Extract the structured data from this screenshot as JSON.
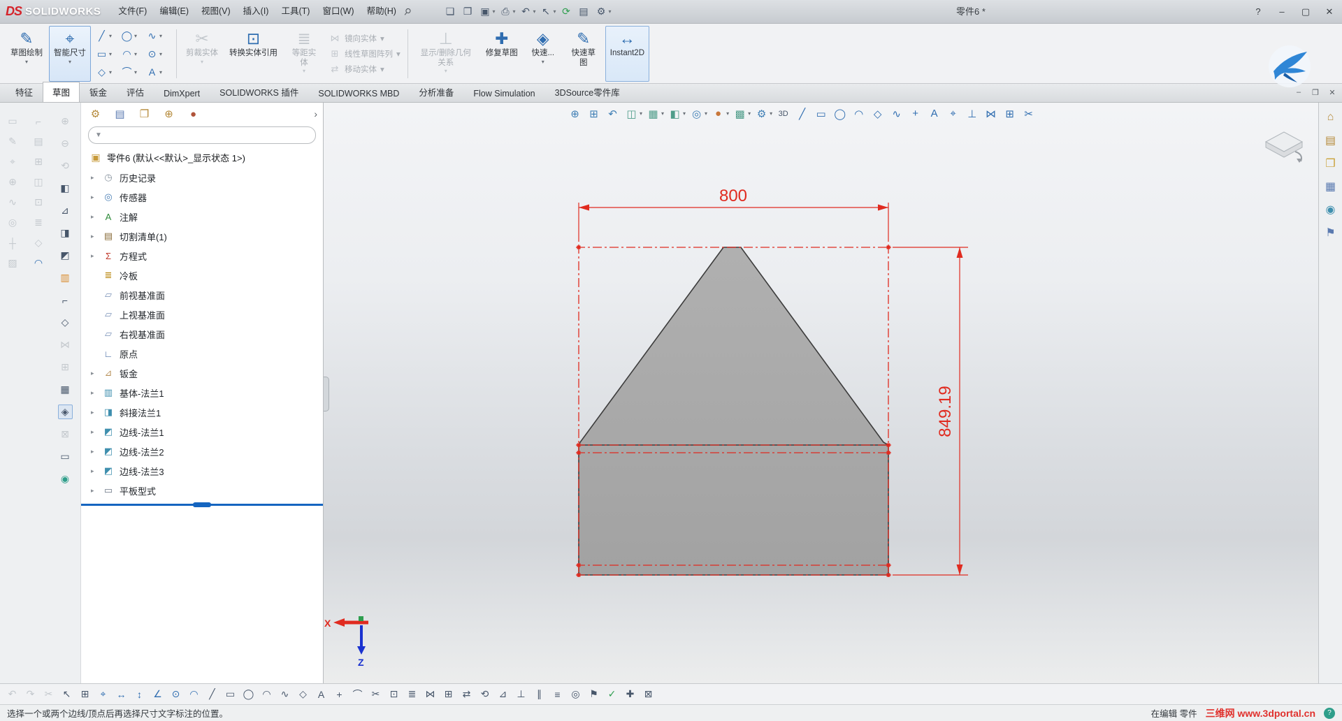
{
  "colors": {
    "accent": "#2f6db0",
    "dim_red": "#e02b20",
    "shape_fill": "#a8a8a8",
    "rollback_blue": "#1565c0"
  },
  "title_bar": {
    "logo_ds": "DS",
    "logo_text": "SOLIDWORKS",
    "menus": [
      {
        "id": "file",
        "label": "文件(F)"
      },
      {
        "id": "edit",
        "label": "编辑(E)"
      },
      {
        "id": "view",
        "label": "视图(V)"
      },
      {
        "id": "insert",
        "label": "插入(I)"
      },
      {
        "id": "tools",
        "label": "工具(T)"
      },
      {
        "id": "window",
        "label": "窗口(W)"
      },
      {
        "id": "help",
        "label": "帮助(H)"
      }
    ],
    "quick_access": [
      {
        "n": "new-document-icon",
        "g": "❏"
      },
      {
        "n": "open-document-icon",
        "g": "❐"
      },
      {
        "n": "save-icon",
        "g": "▣",
        "dd": 1
      },
      {
        "n": "print-icon",
        "g": "⎙",
        "dd": 1
      },
      {
        "n": "undo-icon",
        "g": "↶",
        "dd": 1
      },
      {
        "n": "select-icon",
        "g": "↖",
        "dd": 1
      },
      {
        "n": "rebuild-icon",
        "g": "⟳",
        "c": "#2e9e4f"
      },
      {
        "n": "file-properties-icon",
        "g": "▤"
      },
      {
        "n": "options-icon",
        "g": "⚙",
        "dd": 1
      }
    ],
    "document_title": "零件6 *",
    "help_button": "?",
    "minimize_button": "–",
    "maximize_button": "▢",
    "close_button": "✕"
  },
  "ribbon": {
    "sketch": {
      "label": "草图绘制",
      "icon": "✎"
    },
    "smart_dimension": {
      "label": "智能尺寸",
      "icon": "⌖"
    },
    "entity_tools": [
      {
        "n": "line-tool-icon",
        "g": "╱",
        "c": "#2f6db0",
        "dd": 1
      },
      {
        "n": "circle-tool-icon",
        "g": "◯",
        "c": "#2f6db0",
        "dd": 1
      },
      {
        "n": "spline-tool-icon",
        "g": "∿",
        "c": "#2f6db0",
        "dd": 1
      },
      {
        "n": "rectangle-tool-icon",
        "g": "▭",
        "c": "#2f6db0",
        "dd": 1
      },
      {
        "n": "arc-tool-icon",
        "g": "◠",
        "c": "#2f6db0",
        "dd": 1
      },
      {
        "n": "ellipse-tool-icon",
        "g": "⊙",
        "c": "#2f6db0",
        "dd": 1
      },
      {
        "n": "polygon-tool-icon",
        "g": "◇",
        "c": "#2f6db0",
        "dd": 1
      },
      {
        "n": "fillet-tool-icon",
        "g": "⌒",
        "c": "#2f6db0",
        "dd": 1
      },
      {
        "n": "text-tool-icon",
        "g": "A",
        "c": "#2f6db0",
        "dd": 1
      }
    ],
    "trim": {
      "label": "剪裁实体",
      "icon": "✂"
    },
    "convert": {
      "label": "转换实体引用",
      "icon": "⊡"
    },
    "offset": {
      "label": "等距实体",
      "icon": "≣"
    },
    "mirror": {
      "label": "镜向实体",
      "icon": "⋈"
    },
    "linear_pattern": {
      "label": "线性草图阵列",
      "icon": "⊞"
    },
    "move": {
      "label": "移动实体",
      "icon": "⇄"
    },
    "relations": {
      "label": "显示/删除几何关系",
      "icon": "⊥"
    },
    "repair": {
      "label": "修复草图",
      "icon": "✚"
    },
    "quick_snaps": {
      "label": "快速...",
      "icon": "◈"
    },
    "rapid_sketch": {
      "label": "快速草图",
      "icon": "✎"
    },
    "instant2d": {
      "label": "Instant2D",
      "icon": "↔"
    }
  },
  "command_tabs": {
    "items": [
      {
        "id": "features",
        "label": "特征"
      },
      {
        "id": "sketch",
        "label": "草图",
        "active": true
      },
      {
        "id": "sheet-metal",
        "label": "钣金"
      },
      {
        "id": "evaluate",
        "label": "评估"
      },
      {
        "id": "dimxpert",
        "label": "DimXpert"
      },
      {
        "id": "solidworks-addins",
        "label": "SOLIDWORKS 插件"
      },
      {
        "id": "solidworks-mbd",
        "label": "SOLIDWORKS MBD"
      },
      {
        "id": "analysis-prep",
        "label": "分析准备"
      },
      {
        "id": "flow-simulation",
        "label": "Flow Simulation"
      },
      {
        "id": "3dsource-library",
        "label": "3DSource零件库"
      }
    ],
    "window_icons": [
      {
        "n": "doc-minimize-icon",
        "g": "–"
      },
      {
        "n": "doc-restore-icon",
        "g": "❐"
      },
      {
        "n": "doc-close-icon",
        "g": "✕"
      }
    ]
  },
  "left_dock": {
    "col1": [
      {
        "n": "note-tool-icon",
        "g": "▭",
        "d": 1
      },
      {
        "n": "surface-finish-icon",
        "g": "✎",
        "d": 1
      },
      {
        "n": "geometric-tolerance-icon",
        "g": "⌖",
        "d": 1
      },
      {
        "n": "datum-feature-icon",
        "g": "⊕",
        "d": 1
      },
      {
        "n": "weld-symbol-icon",
        "g": "∿",
        "d": 1
      },
      {
        "n": "balloon-icon",
        "g": "◎",
        "d": 1
      },
      {
        "n": "center-mark-icon",
        "g": "┼",
        "d": 1
      },
      {
        "n": "area-hatch-icon",
        "g": "▨",
        "d": 1
      }
    ],
    "col2": [
      {
        "n": "blocks-tool-icon",
        "g": "⌐",
        "d": 1
      },
      {
        "n": "table-tool-icon",
        "g": "▤",
        "d": 1
      },
      {
        "n": "pattern-tool-icon",
        "g": "⊞",
        "d": 1
      },
      {
        "n": "section-tool-icon",
        "g": "◫",
        "d": 1
      },
      {
        "n": "convert-tool-icon",
        "g": "⊡",
        "d": 1
      },
      {
        "n": "offset-tool-icon",
        "g": "≣",
        "d": 1
      },
      {
        "n": "polygon-dock-icon",
        "g": "◇",
        "d": 1
      },
      {
        "n": "arc-dock-icon",
        "g": "◠",
        "c": "#2f6db0"
      }
    ],
    "col3": [
      {
        "n": "extruded-boss-icon",
        "g": "⊕",
        "d": 1
      },
      {
        "n": "extruded-cut-icon",
        "g": "⊖",
        "d": 1
      },
      {
        "n": "revolve-icon",
        "g": "⟲",
        "d": 1
      },
      {
        "n": "fillet-feature-icon",
        "g": "◧"
      },
      {
        "n": "chamfer-feature-icon",
        "g": "⊿"
      },
      {
        "n": "base-flange-tool-icon",
        "g": "◨"
      },
      {
        "n": "edge-flange-tool-icon",
        "g": "◩"
      },
      {
        "n": "miter-flange-tool-icon",
        "g": "▥",
        "c": "#d98a2b"
      },
      {
        "n": "hem-tool-icon",
        "g": "⌐"
      },
      {
        "n": "jog-tool-icon",
        "g": "◇"
      },
      {
        "n": "mirror-feature-icon",
        "g": "⋈",
        "d": 1
      },
      {
        "n": "linear-pattern-feature-icon",
        "g": "⊞",
        "d": 1
      },
      {
        "n": "rib-tool-icon",
        "g": "▦"
      },
      {
        "n": "unfold-tool-icon",
        "g": "◈",
        "p": 1
      },
      {
        "n": "fold-tool-icon",
        "g": "⊠",
        "d": 1
      },
      {
        "n": "flatten-tool-icon",
        "g": "▭"
      },
      {
        "n": "appearance-sphere-icon",
        "g": "◉",
        "c": "#2e9e8a"
      }
    ]
  },
  "feature_tree": {
    "header_icons": [
      {
        "n": "featuremanager-tab-icon",
        "g": "⚙",
        "c": "#b58a3a"
      },
      {
        "n": "propertymanager-tab-icon",
        "g": "▤",
        "c": "#5a7ab0"
      },
      {
        "n": "configurationmanager-tab-icon",
        "g": "❐",
        "c": "#b58a3a"
      },
      {
        "n": "dimxpertmanager-tab-icon",
        "g": "⊕",
        "c": "#b58a3a"
      },
      {
        "n": "displaymanager-tab-icon",
        "g": "●",
        "c": "#b0543a"
      }
    ],
    "collapse_arrow": "›",
    "filter": {
      "value": ""
    },
    "root": {
      "n": "part-icon",
      "g": "▣",
      "c": "#c79a3a",
      "label": "零件6 (默认<<默认>_显示状态 1>)"
    },
    "items": [
      {
        "n": "history-folder-icon",
        "g": "◷",
        "c": "#8a95a0",
        "label": "历史记录",
        "arrow": true
      },
      {
        "n": "sensors-icon",
        "g": "◎",
        "c": "#4a7fb5",
        "label": "传感器",
        "arrow": true
      },
      {
        "n": "annotations-icon",
        "g": "A",
        "c": "#2e8b3a",
        "label": "注解",
        "arrow": true
      },
      {
        "n": "cut-list-icon",
        "g": "▤",
        "c": "#8a6d3b",
        "label": "切割清单(1)",
        "arrow": true
      },
      {
        "n": "equations-icon",
        "g": "Σ",
        "c": "#c0392b",
        "label": "方程式",
        "arrow": true
      },
      {
        "n": "material-icon",
        "g": "≣",
        "c": "#b8860b",
        "label": "冷板",
        "arrow": false
      },
      {
        "n": "front-plane-icon",
        "g": "▱",
        "c": "#7a92b8",
        "label": "前视基准面",
        "arrow": false
      },
      {
        "n": "top-plane-icon",
        "g": "▱",
        "c": "#7a92b8",
        "label": "上视基准面",
        "arrow": false
      },
      {
        "n": "right-plane-icon",
        "g": "▱",
        "c": "#7a92b8",
        "label": "右视基准面",
        "arrow": false
      },
      {
        "n": "origin-icon",
        "g": "∟",
        "c": "#4a6fa5",
        "label": "原点",
        "arrow": false
      },
      {
        "n": "sheet-metal-folder-icon",
        "g": "⊿",
        "c": "#b8915a",
        "label": "钣金",
        "arrow": true
      },
      {
        "n": "base-flange-icon",
        "g": "▥",
        "c": "#3f8fae",
        "label": "基体-法兰1",
        "arrow": true
      },
      {
        "n": "miter-flange-icon",
        "g": "◨",
        "c": "#3f8fae",
        "label": "斜接法兰1",
        "arrow": true
      },
      {
        "n": "edge-flange-icon",
        "g": "◩",
        "c": "#3f8fae",
        "label": "边线-法兰1",
        "arrow": true
      },
      {
        "n": "edge-flange-icon",
        "g": "◩",
        "c": "#3f8fae",
        "label": "边线-法兰2",
        "arrow": true
      },
      {
        "n": "edge-flange-icon",
        "g": "◩",
        "c": "#3f8fae",
        "label": "边线-法兰3",
        "arrow": true
      },
      {
        "n": "flat-pattern-icon",
        "g": "▭",
        "c": "#6a7684",
        "label": "平板型式",
        "arrow": true
      }
    ]
  },
  "viewport": {
    "hud_icons": [
      {
        "n": "zoom-fit-icon",
        "g": "⊕",
        "c": "#3f7fb5"
      },
      {
        "n": "zoom-area-icon",
        "g": "⊞",
        "c": "#3f7fb5"
      },
      {
        "n": "previous-view-icon",
        "g": "↶",
        "c": "#3f7fb5"
      },
      {
        "n": "section-view-icon",
        "g": "◫",
        "c": "#4f9d8a",
        "dd": 1
      },
      {
        "n": "view-orientation-icon",
        "g": "▦",
        "c": "#4f9d8a",
        "dd": 1
      },
      {
        "n": "display-style-icon",
        "g": "◧",
        "c": "#4f9d8a",
        "dd": 1
      },
      {
        "n": "hide-show-items-icon",
        "g": "◎",
        "c": "#3f7fb5",
        "dd": 1
      },
      {
        "n": "edit-appearance-icon",
        "g": "●",
        "c": "#c8773a",
        "dd": 1
      },
      {
        "n": "apply-scene-icon",
        "g": "▩",
        "c": "#4f9d8a",
        "dd": 1
      },
      {
        "n": "view-settings-icon",
        "g": "⚙",
        "c": "#3f7fb5",
        "dd": 1
      },
      {
        "n": "3d-sketch-icon",
        "g": "3D",
        "fs": 11
      },
      {
        "n": "sketch-line-icon",
        "g": "╱",
        "c": "#2f6db0"
      },
      {
        "n": "sketch-rectangle-icon",
        "g": "▭",
        "c": "#2f6db0"
      },
      {
        "n": "sketch-circle-icon",
        "g": "◯",
        "c": "#2f6db0"
      },
      {
        "n": "sketch-arc-icon",
        "g": "◠",
        "c": "#2f6db0"
      },
      {
        "n": "sketch-polygon-icon",
        "g": "◇",
        "c": "#2f6db0"
      },
      {
        "n": "sketch-spline-icon",
        "g": "∿",
        "c": "#2f6db0"
      },
      {
        "n": "sketch-point-icon",
        "g": "+",
        "c": "#2f6db0"
      },
      {
        "n": "sketch-text-icon",
        "g": "A",
        "c": "#2f6db0"
      },
      {
        "n": "sketch-dimension-icon",
        "g": "⌖",
        "c": "#2f6db0"
      },
      {
        "n": "sketch-relation-icon",
        "g": "⊥",
        "c": "#2f6db0"
      },
      {
        "n": "sketch-mirror-icon",
        "g": "⋈",
        "c": "#2f6db0"
      },
      {
        "n": "sketch-pattern-icon",
        "g": "⊞",
        "c": "#2f6db0"
      },
      {
        "n": "sketch-trim-icon",
        "g": "✂",
        "c": "#2f6db0"
      }
    ],
    "dim_width": "800",
    "dim_height": "849.19",
    "triad_x": "X",
    "triad_z": "Z"
  },
  "task_pane": {
    "icons": [
      {
        "n": "task-pane-home-icon",
        "g": "⌂",
        "c": "#b58a3a"
      },
      {
        "n": "design-library-icon",
        "g": "▤",
        "c": "#b58a3a"
      },
      {
        "n": "file-explorer-icon",
        "g": "❒",
        "c": "#caa23a"
      },
      {
        "n": "view-palette-icon",
        "g": "▦",
        "c": "#5a7ab0"
      },
      {
        "n": "appearances-icon",
        "g": "◉",
        "c": "#3f8fae"
      },
      {
        "n": "custom-properties-icon",
        "g": "⚑",
        "c": "#5a7ab0"
      }
    ]
  },
  "bottom_toolbar": {
    "icons": [
      {
        "n": "undo-icon",
        "g": "↶",
        "d": 1
      },
      {
        "n": "redo-icon",
        "g": "↷",
        "d": 1
      },
      {
        "n": "cut-icon",
        "g": "✂",
        "d": 1
      },
      {
        "n": "select-arrow-icon",
        "g": "↖"
      },
      {
        "n": "snap-grid-icon",
        "g": "⊞"
      },
      {
        "n": "smart-dimension-icon",
        "g": "⌖",
        "c": "#2f6db0"
      },
      {
        "n": "horizontal-dimension-icon",
        "g": "↔",
        "c": "#2f6db0"
      },
      {
        "n": "vertical-dimension-icon",
        "g": "↕",
        "c": "#2f6db0"
      },
      {
        "n": "angle-dimension-icon",
        "g": "∠",
        "c": "#2f6db0"
      },
      {
        "n": "diameter-dimension-icon",
        "g": "⊙",
        "c": "#2f6db0"
      },
      {
        "n": "radius-dimension-icon",
        "g": "◠",
        "c": "#2f6db0"
      },
      {
        "n": "line-tool-icon",
        "g": "╱"
      },
      {
        "n": "rectangle-tool-icon",
        "g": "▭"
      },
      {
        "n": "circle-tool-icon",
        "g": "◯"
      },
      {
        "n": "arc-tool-icon",
        "g": "◠"
      },
      {
        "n": "spline-tool-icon",
        "g": "∿"
      },
      {
        "n": "polygon-tool-icon",
        "g": "◇"
      },
      {
        "n": "text-tool-icon",
        "g": "A"
      },
      {
        "n": "point-tool-icon",
        "g": "+"
      },
      {
        "n": "fillet-tool-icon",
        "g": "⌒"
      },
      {
        "n": "trim-tool-icon",
        "g": "✂"
      },
      {
        "n": "convert-entities-icon",
        "g": "⊡"
      },
      {
        "n": "offset-entities-icon",
        "g": "≣"
      },
      {
        "n": "mirror-entities-icon",
        "g": "⋈"
      },
      {
        "n": "linear-pattern-icon",
        "g": "⊞"
      },
      {
        "n": "move-entities-icon",
        "g": "⇄"
      },
      {
        "n": "rotate-entities-icon",
        "g": "⟲"
      },
      {
        "n": "chamfer-tool-icon",
        "g": "⊿"
      },
      {
        "n": "perpendicular-relation-icon",
        "g": "⊥"
      },
      {
        "n": "parallel-relation-icon",
        "g": "∥"
      },
      {
        "n": "coincident-relation-icon",
        "g": "≡"
      },
      {
        "n": "concentric-relation-icon",
        "g": "◎"
      },
      {
        "n": "fix-relation-icon",
        "g": "⚑"
      },
      {
        "n": "fully-define-sketch-icon",
        "g": "✓",
        "c": "#2e9e4f"
      },
      {
        "n": "repair-sketch-icon",
        "g": "✚"
      },
      {
        "n": "exit-sketch-icon",
        "g": "⊠"
      }
    ]
  },
  "status_bar": {
    "message": "选择一个或两个边线/顶点后再选择尺寸文字标注的位置。",
    "editing": "在编辑 零件",
    "watermark": "三维网 www.3dportal.cn"
  }
}
